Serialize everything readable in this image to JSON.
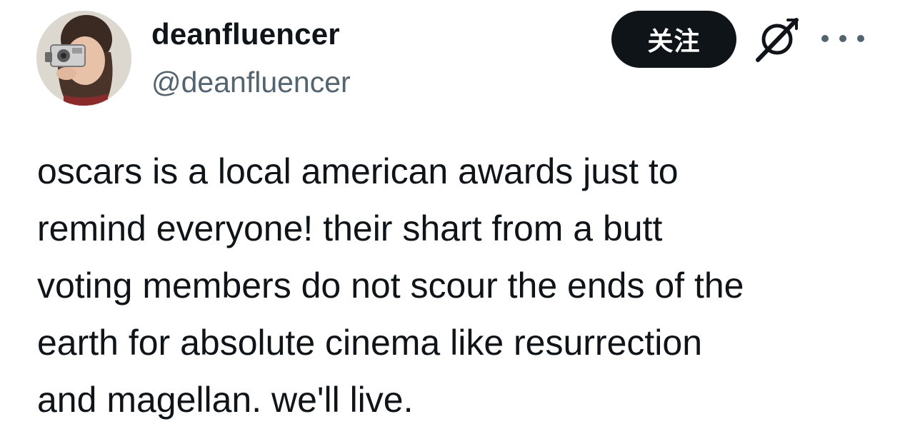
{
  "tweet": {
    "author": {
      "display_name": "deanfluencer",
      "handle": "@deanfluencer",
      "avatar_icon": "profile-photo"
    },
    "actions": {
      "follow_label": "关注",
      "grok_icon": "grok-icon",
      "more_icon": "more-options-icon"
    },
    "text": "oscars is a local american awards just to\nremind everyone! their shart from a butt\nvoting members do not scour the ends of the\nearth for absolute cinema like resurrection\nand magellan. we'll live."
  },
  "colors": {
    "primary_text": "#0f1419",
    "secondary_text": "#536471",
    "follow_button_bg": "#0f1419",
    "follow_button_text": "#ffffff",
    "background": "#ffffff"
  }
}
